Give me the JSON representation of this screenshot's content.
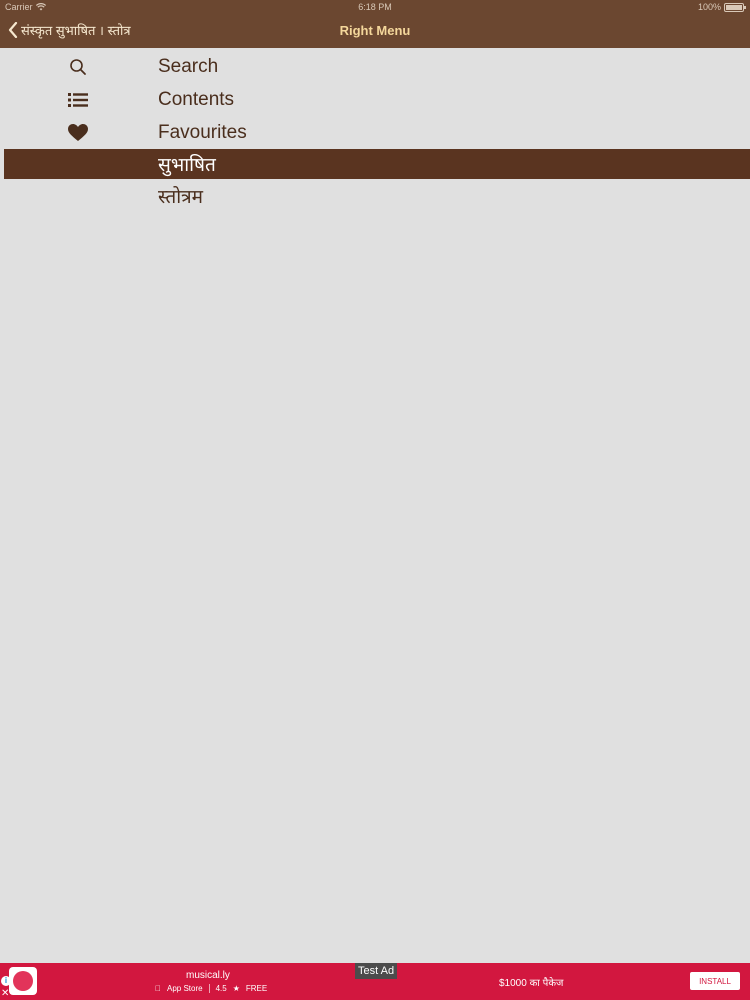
{
  "status_bar": {
    "carrier": "Carrier",
    "time": "6:18 PM",
    "battery": "100%"
  },
  "nav": {
    "back_label": "संस्कृत सुभाषित । स्तोत्र",
    "title": "Right Menu"
  },
  "menu": {
    "items": [
      {
        "label": "Search",
        "icon": "search-icon"
      },
      {
        "label": "Contents",
        "icon": "list-icon"
      },
      {
        "label": "Favourites",
        "icon": "heart-icon"
      },
      {
        "label": "सुभाषित",
        "icon": "",
        "selected": true
      },
      {
        "label": "स्तोत्रम",
        "icon": ""
      }
    ]
  },
  "ad": {
    "app_name": "musical.ly",
    "store": "App Store",
    "rating": "4.5",
    "price": "FREE",
    "badge": "Test Ad",
    "promo": "$1000 का पैकेज",
    "install": "INSTALL"
  },
  "colors": {
    "nav_bg": "#6b4730",
    "nav_title": "#f4d79b",
    "menu_text": "#4a2e1d",
    "selected_bg": "#5a3420",
    "background": "#e0e0e0",
    "ad_bg": "#d2173f"
  }
}
